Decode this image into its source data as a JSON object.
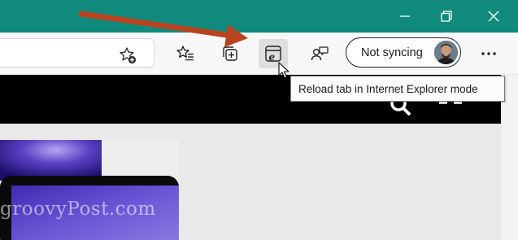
{
  "window": {
    "title_bar_color": "#0f8a7d",
    "controls": [
      {
        "name": "minimize",
        "icon": "minimize-icon"
      },
      {
        "name": "restore",
        "icon": "restore-icon"
      },
      {
        "name": "close",
        "icon": "close-icon"
      }
    ]
  },
  "toolbar": {
    "address_bar": {
      "value": "",
      "favorite_icon": "add-favorite-star-icon"
    },
    "buttons": [
      {
        "name": "favorites",
        "icon": "favorites-icon"
      },
      {
        "name": "collections",
        "icon": "collections-icon"
      },
      {
        "name": "ie-mode-reload",
        "icon": "ie-mode-icon",
        "active": true
      },
      {
        "name": "feedback",
        "icon": "feedback-icon"
      }
    ],
    "sync": {
      "label": "Not syncing",
      "avatar": "profile-avatar"
    },
    "more_icon": "more-dots-icon"
  },
  "tooltip": {
    "text": "Reload tab in Internet Explorer mode"
  },
  "annotation": {
    "arrow_color": "#b8431f"
  },
  "watermark": {
    "text": "groovyPost.com"
  }
}
